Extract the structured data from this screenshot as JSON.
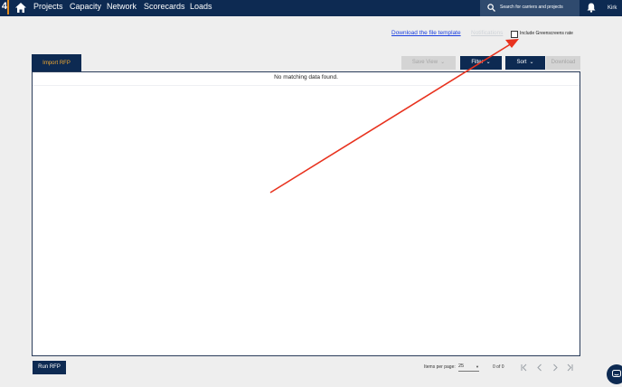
{
  "nav": {
    "logo_text": "4",
    "items": [
      {
        "label": "Projects"
      },
      {
        "label": "Capacity"
      },
      {
        "label": "Network"
      },
      {
        "label": "Scorecards"
      },
      {
        "label": "Loads"
      }
    ],
    "search_placeholder": "Search for carriers and projects",
    "user_name": "Kirk"
  },
  "toolbar": {
    "download_template": "Download the file template",
    "notifications": "Notifications",
    "greenscreens_checkbox": {
      "label": "Include Greenscreens rate",
      "checked": false
    }
  },
  "actions": {
    "import_rfp": "Import RFP",
    "save_view": "Save View",
    "filter": "Filter",
    "sort": "Sort",
    "download": "Download"
  },
  "table": {
    "empty_message": "No matching data found."
  },
  "footer": {
    "run_rfp": "Run RFP",
    "items_per_page_label": "Items per page:",
    "items_per_page_value": "25",
    "range_label": "0 of 0"
  },
  "colors": {
    "navy": "#0d2a52",
    "accent_orange": "#f0a830",
    "link_blue": "#1a3fe0",
    "annotation_red": "#e8321e"
  }
}
